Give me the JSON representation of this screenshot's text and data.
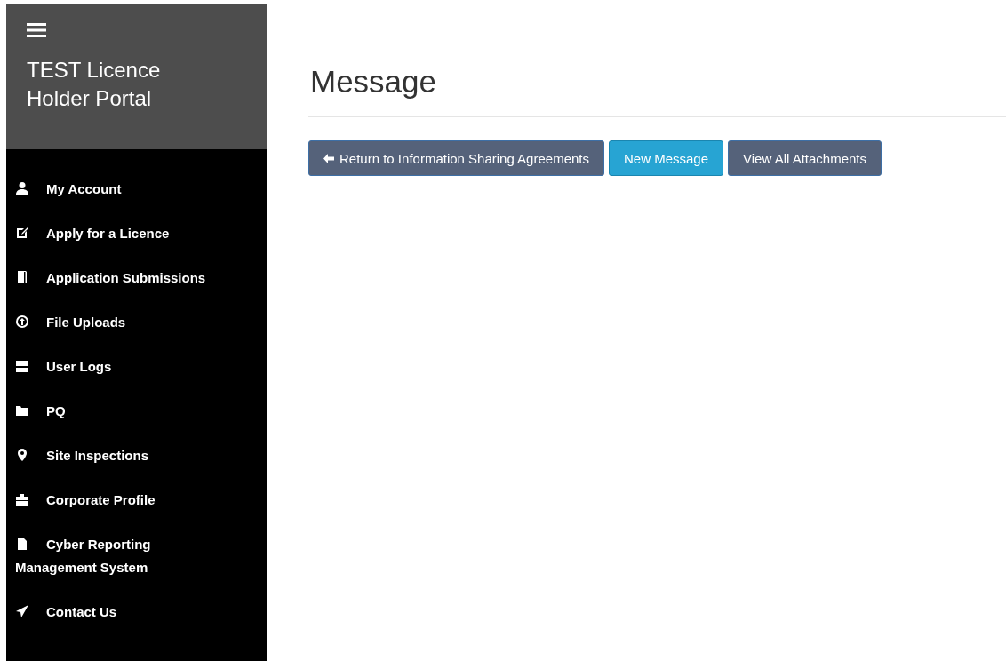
{
  "sidebar": {
    "title": "TEST Licence Holder Portal",
    "items": [
      {
        "label": "My Account",
        "kind": "user"
      },
      {
        "label": "Apply for a Licence",
        "kind": "edit"
      },
      {
        "label": "Application Submissions",
        "kind": "book"
      },
      {
        "label": "File Uploads",
        "kind": "upload"
      },
      {
        "label": "User Logs",
        "kind": "logs"
      },
      {
        "label": "PQ",
        "kind": "folder"
      },
      {
        "label": "Site Inspections",
        "kind": "pin"
      },
      {
        "label": "Corporate Profile",
        "kind": "briefcase"
      },
      {
        "label": "Cyber Reporting Management System",
        "kind": "file"
      },
      {
        "label": "Contact Us",
        "kind": "send"
      }
    ]
  },
  "page": {
    "title": "Message",
    "buttons": [
      {
        "label": "Return to Information Sharing Agreements",
        "kind": "back"
      },
      {
        "label": "New Message",
        "kind": "primary"
      },
      {
        "label": "View All Attachments",
        "kind": "default"
      }
    ]
  }
}
